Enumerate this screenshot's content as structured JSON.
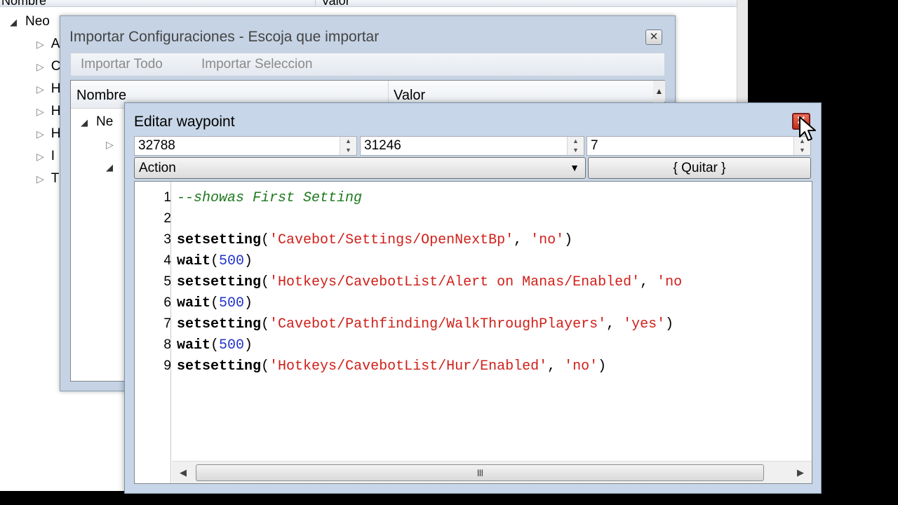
{
  "main_window": {
    "columns": [
      "Nombre",
      "Valor"
    ],
    "tree": [
      {
        "label": "Neo",
        "state": "open"
      },
      {
        "label": "A",
        "state": "closed"
      },
      {
        "label": "C",
        "state": "closed"
      },
      {
        "label": "H",
        "state": "closed"
      },
      {
        "label": "H",
        "state": "closed"
      },
      {
        "label": "H",
        "state": "closed"
      },
      {
        "label": "I",
        "state": "closed"
      },
      {
        "label": "T",
        "state": "closed"
      }
    ]
  },
  "import_window": {
    "title": "Importar Configuraciones - Escoja que importar",
    "menu": [
      "Importar Todo",
      "Importar Seleccion"
    ],
    "columns": [
      "Nombre",
      "Valor"
    ],
    "tree": [
      {
        "label": "Ne",
        "state": "open"
      },
      {
        "label": "",
        "state": "closed"
      },
      {
        "label": "",
        "state": "open"
      }
    ]
  },
  "waypoint_window": {
    "title": "Editar waypoint",
    "x": "32788",
    "y": "31246",
    "z": "7",
    "type_select": "Action",
    "remove_button": "{ Quitar }",
    "scroll_thumb_grip": "III",
    "code_lines": [
      {
        "n": "1",
        "tokens": [
          {
            "t": "--showas First Setting",
            "k": "c"
          }
        ]
      },
      {
        "n": "2",
        "tokens": []
      },
      {
        "n": "3",
        "tokens": [
          {
            "t": "setsetting",
            "k": "b"
          },
          {
            "t": "(",
            "k": "p"
          },
          {
            "t": "'Cavebot/Settings/OpenNextBp'",
            "k": "s"
          },
          {
            "t": ", ",
            "k": "p"
          },
          {
            "t": "'no'",
            "k": "s"
          },
          {
            "t": ")",
            "k": "p"
          }
        ]
      },
      {
        "n": "4",
        "tokens": [
          {
            "t": "wait",
            "k": "b"
          },
          {
            "t": "(",
            "k": "p"
          },
          {
            "t": "500",
            "k": "n"
          },
          {
            "t": ")",
            "k": "p"
          }
        ]
      },
      {
        "n": "5",
        "tokens": [
          {
            "t": "setsetting",
            "k": "b"
          },
          {
            "t": "(",
            "k": "p"
          },
          {
            "t": "'Hotkeys/CavebotList/Alert on Manas/Enabled'",
            "k": "s"
          },
          {
            "t": ", ",
            "k": "p"
          },
          {
            "t": "'no",
            "k": "s"
          }
        ]
      },
      {
        "n": "6",
        "tokens": [
          {
            "t": "wait",
            "k": "b"
          },
          {
            "t": "(",
            "k": "p"
          },
          {
            "t": "500",
            "k": "n"
          },
          {
            "t": ")",
            "k": "p"
          }
        ]
      },
      {
        "n": "7",
        "tokens": [
          {
            "t": "setsetting",
            "k": "b"
          },
          {
            "t": "(",
            "k": "p"
          },
          {
            "t": "'Cavebot/Pathfinding/WalkThroughPlayers'",
            "k": "s"
          },
          {
            "t": ", ",
            "k": "p"
          },
          {
            "t": "'yes'",
            "k": "s"
          },
          {
            "t": ")",
            "k": "p"
          }
        ]
      },
      {
        "n": "8",
        "tokens": [
          {
            "t": "wait",
            "k": "b"
          },
          {
            "t": "(",
            "k": "p"
          },
          {
            "t": "500",
            "k": "n"
          },
          {
            "t": ")",
            "k": "p"
          }
        ]
      },
      {
        "n": "9",
        "tokens": [
          {
            "t": "setsetting",
            "k": "b"
          },
          {
            "t": "(",
            "k": "p"
          },
          {
            "t": "'Hotkeys/CavebotList/Hur/Enabled'",
            "k": "s"
          },
          {
            "t": ", ",
            "k": "p"
          },
          {
            "t": "'no'",
            "k": "s"
          },
          {
            "t": ")",
            "k": "p"
          }
        ]
      }
    ]
  },
  "icons": {
    "close": "close-icon",
    "spin_up": "chevron-up-icon",
    "spin_down": "chevron-down-icon",
    "dropdown": "caret-down-icon",
    "scroll_left": "scroll-left-icon",
    "scroll_right": "scroll-right-icon",
    "cursor": "mouse-pointer-icon"
  },
  "colors": {
    "window_frame": "#c7d6e8",
    "string": "#d0201a",
    "number": "#2233cc",
    "comment": "#1e7a1e",
    "close_button": "#c0301c"
  }
}
